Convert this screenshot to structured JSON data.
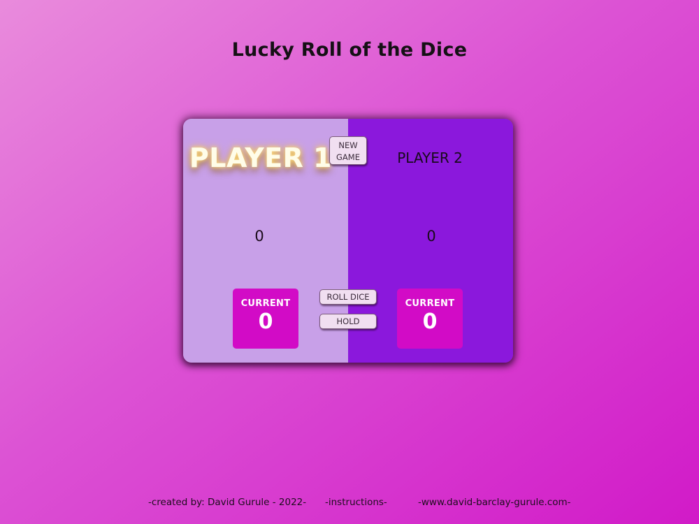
{
  "page": {
    "title": "Lucky Roll of the Dice"
  },
  "players": [
    {
      "name": "PLAYER 1",
      "total_score": "0",
      "current_label": "CURRENT",
      "current_score": "0",
      "active": true
    },
    {
      "name": "PLAYER 2",
      "total_score": "0",
      "current_label": "CURRENT",
      "current_score": "0",
      "active": false
    }
  ],
  "buttons": {
    "new_game_line1": "NEW",
    "new_game_line2": "GAME",
    "roll_dice": "ROLL DICE",
    "hold": "HOLD"
  },
  "footer": {
    "credit": "-created by: David Gurule - 2022-",
    "instructions": "-instructions-",
    "website": "-www.david-barclay-gurule.com-"
  },
  "colors": {
    "player1_panel": "#c8a0e8",
    "player2_panel": "#8b18dc",
    "current_box": "#d20bc6",
    "background_start": "#e98bdc",
    "background_end": "#d11ac8"
  }
}
